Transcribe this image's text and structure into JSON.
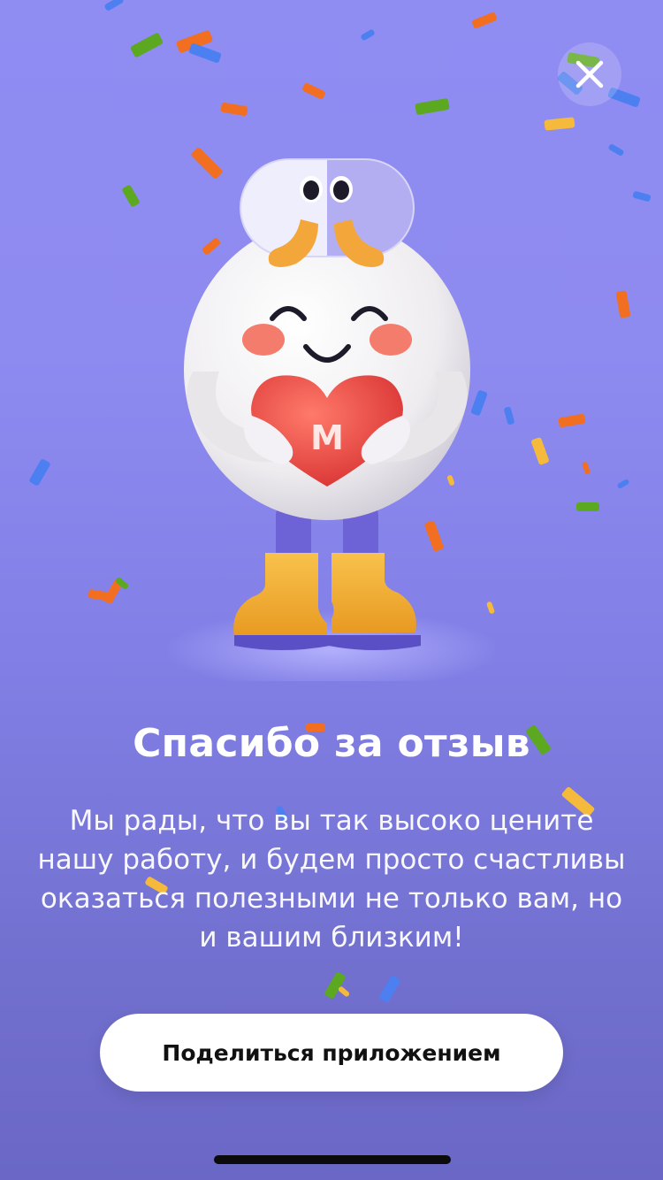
{
  "modal": {
    "title": "Спасибо за отзыв",
    "message": "Мы рады, что вы так высоко цените нашу работу, и будем просто счастливы оказаться полезными не только вам, но и вашим близким!",
    "share_button_label": "Поделиться приложением",
    "close_icon": "close-icon"
  },
  "illustration": {
    "subject": "mascot-icon",
    "heart_logo": "M"
  },
  "colors": {
    "background": "#8f8cf2",
    "button_bg": "#ffffff",
    "button_text": "#111111",
    "title_text": "#ffffff",
    "heart": "#e54545",
    "boots": "#f5b93c",
    "legs": "#6e63d6",
    "cheeks": "#f47c6c",
    "confetti_orange": "#f26f21",
    "confetti_green": "#5ca820",
    "confetti_blue": "#4c7ff0"
  }
}
